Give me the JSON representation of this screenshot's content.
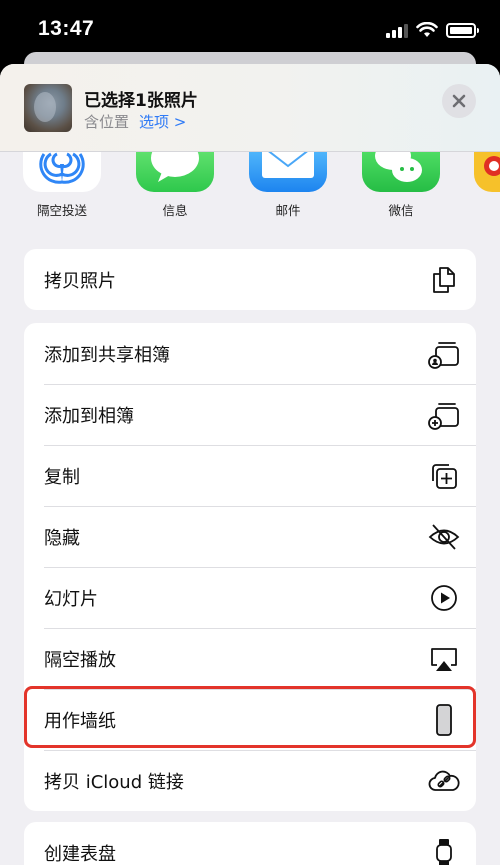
{
  "status_bar": {
    "time": "13:47"
  },
  "header": {
    "title": "已选择1张照片",
    "location_label": "含位置",
    "options_label": "选项 >"
  },
  "apps": [
    {
      "label": "隔空投送",
      "icon": "airdrop-icon"
    },
    {
      "label": "信息",
      "icon": "messages-icon"
    },
    {
      "label": "邮件",
      "icon": "mail-icon"
    },
    {
      "label": "微信",
      "icon": "wechat-icon"
    }
  ],
  "actions": {
    "copy_photo": "拷贝照片",
    "add_shared_album": "添加到共享相簿",
    "add_album": "添加到相簿",
    "duplicate": "复制",
    "hide": "隐藏",
    "slideshow": "幻灯片",
    "airplay": "隔空播放",
    "wallpaper": "用作墙纸",
    "copy_icloud": "拷贝 iCloud 链接",
    "watch_face": "创建表盘"
  },
  "colors": {
    "accent": "#2f7bf6",
    "highlight": "#e3342a",
    "sheet_bg": "#f0eff3"
  }
}
